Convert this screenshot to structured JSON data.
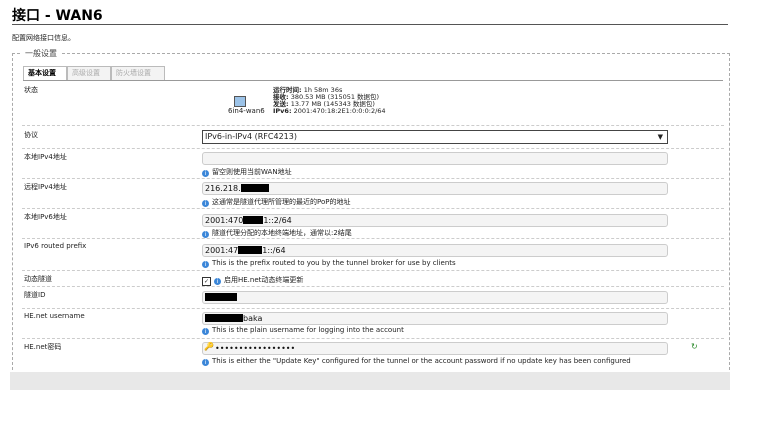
{
  "page": {
    "title": "接口 - WAN6",
    "description": "配置网络接口信息。"
  },
  "section": {
    "legend": "一般设置"
  },
  "tabs": [
    {
      "label": "基本设置",
      "active": true
    },
    {
      "label": "高级设置",
      "active": false
    },
    {
      "label": "防火墙设置",
      "active": false
    }
  ],
  "status": {
    "label": "状态",
    "iface": "6in4-wan6",
    "uptime_label": "运行时间:",
    "uptime": "1h 58m 36s",
    "rx_label": "接收:",
    "rx": "380.53 MB (315051 数据包)",
    "tx_label": "发送:",
    "tx": "13.77 MB (145343 数据包)",
    "ipv6_label": "IPv6:",
    "ipv6": "2001:470:18:2E1:0:0:0:2/64"
  },
  "protocol": {
    "label": "协议",
    "value": "IPv6-in-IPv4 (RFC4213)"
  },
  "local_ipv4": {
    "label": "本地IPv4地址",
    "value": "",
    "hint": "留空则使用当前WAN地址"
  },
  "remote_ipv4": {
    "label": "远程IPv4地址",
    "value_prefix": "216.218.",
    "hint": "这通常是隧道代理所管理的最近的PoP的地址"
  },
  "local_ipv6": {
    "label": "本地IPv6地址",
    "value_prefix": "2001:470",
    "value_suffix": "1::2/64",
    "hint": "隧道代理分配的本地终端地址，通常以:2结尾"
  },
  "routed_prefix": {
    "label": "IPv6 routed prefix",
    "value_prefix": "2001:47",
    "value_suffix": "1::/64",
    "hint": "This is the prefix routed to you by the tunnel broker for use by clients"
  },
  "dynamic_tunnel": {
    "label": "动态隧道",
    "checked": true,
    "hint": "启用HE.net动态终端更新"
  },
  "tunnel_id": {
    "label": "隧道ID"
  },
  "username": {
    "label": "HE.net username",
    "value_suffix": "baka",
    "hint": "This is the plain username for logging into the account"
  },
  "password": {
    "label": "HE.net密码",
    "value": "•••••••••••••••••",
    "hint": "This is either the \"Update Key\" configured for the tunnel or the account password if no update key has been configured"
  },
  "icons": {
    "info": "info-icon",
    "key": "key-icon",
    "reveal": "reveal-password-icon"
  }
}
